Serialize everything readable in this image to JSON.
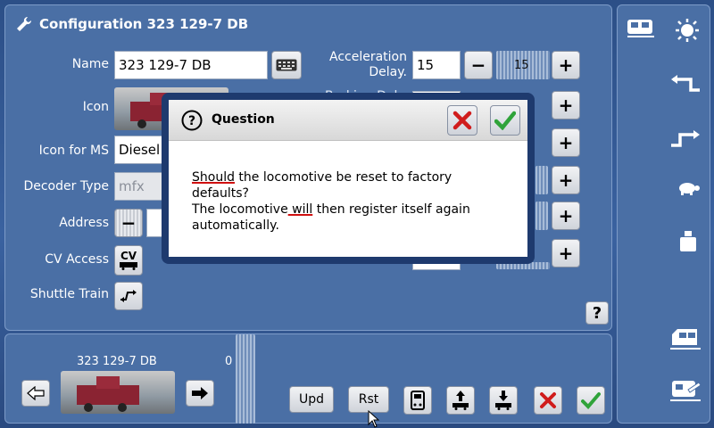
{
  "header": {
    "title": "Configuration 323 129-7 DB"
  },
  "form": {
    "name_label": "Name",
    "name_value": "323 129-7 DB",
    "icon_label": "Icon",
    "icon_for_ms_label": "Icon for MS",
    "icon_for_ms_value": "Diesel",
    "decoder_type_label": "Decoder Type",
    "decoder_type_value": "mfx",
    "address_label": "Address",
    "cv_access_label": "CV Access",
    "cv_button_label": "CV",
    "shuttle_train_label": "Shuttle Train"
  },
  "params": {
    "acceleration_label": "Acceleration Delay.",
    "acceleration_value": "15",
    "acceleration_slider_value": "15",
    "braking_label_partial": "Braking Dela"
  },
  "dialog": {
    "title": "Question",
    "line1_word": "Should",
    "line1_rest": " the locomotive be reset to factory defaults?",
    "line2_a": "The locomotive",
    "line2_word": " will",
    "line2_rest": " then register itself again automatically."
  },
  "bottom": {
    "loco_name": "323 129-7 DB",
    "speed_value": "0",
    "upd_label": "Upd",
    "rst_label": "Rst"
  },
  "colors": {
    "panel": "#4a6fa5",
    "dialog_frame": "#1e3a6e",
    "cancel_red": "#d01c1c",
    "confirm_green": "#2fa33a"
  },
  "help_label": "?"
}
